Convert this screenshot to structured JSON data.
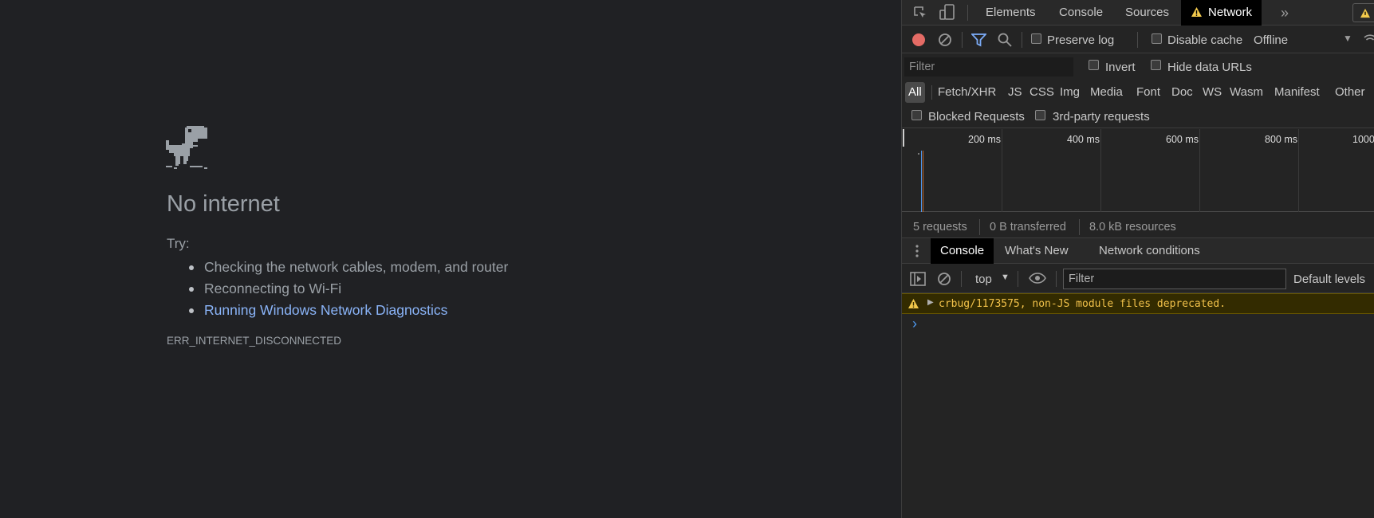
{
  "page": {
    "title": "No internet",
    "try_label": "Try:",
    "suggestions": [
      "Checking the network cables, modem, and router",
      "Reconnecting to Wi-Fi",
      "Running Windows Network Diagnostics"
    ],
    "error_code": "ERR_INTERNET_DISCONNECTED",
    "colors": {
      "background": "#202124",
      "text": "#9aa0a6",
      "link": "#8ab4f8"
    }
  },
  "devtools": {
    "tabs": [
      "Elements",
      "Console",
      "Sources",
      "Network"
    ],
    "active_tab": "Network",
    "more_tabs_icon": "chevron-double-right-icon",
    "network_toolbar": {
      "preserve_log": "Preserve log",
      "disable_cache": "Disable cache",
      "throttling": "Offline"
    },
    "filter": {
      "placeholder": "Filter",
      "invert": "Invert",
      "hide_data_urls": "Hide data URLs"
    },
    "types": [
      "All",
      "Fetch/XHR",
      "JS",
      "CSS",
      "Img",
      "Media",
      "Font",
      "Doc",
      "WS",
      "Wasm",
      "Manifest",
      "Other"
    ],
    "active_type": "All",
    "blocked_requests": "Blocked Requests",
    "third_party": "3rd-party requests",
    "timeline_ticks": [
      "200 ms",
      "400 ms",
      "600 ms",
      "800 ms",
      "1000"
    ],
    "summary": {
      "requests": "5 requests",
      "transferred": "0 B transferred",
      "resources": "8.0 kB resources"
    },
    "drawer_tabs": [
      "Console",
      "What's New",
      "Network conditions"
    ],
    "console": {
      "context": "top",
      "filter_placeholder": "Filter",
      "levels": "Default levels",
      "warning": "crbug/1173575, non-JS module files deprecated.",
      "prompt": "›"
    },
    "colors": {
      "record": "#e46b65",
      "filter_active": "#7cacf8",
      "warning_text": "#f2c24a",
      "warning_bg": "#332b00"
    }
  }
}
